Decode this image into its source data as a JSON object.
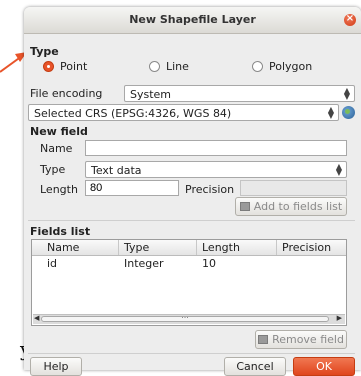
{
  "background_text": "y",
  "dialog": {
    "title": "New Shapefile Layer",
    "close_icon": "close-icon",
    "accent_color": "#e8542a"
  },
  "type": {
    "label": "Type",
    "options": [
      {
        "label": "Point",
        "checked": true
      },
      {
        "label": "Line",
        "checked": false
      },
      {
        "label": "Polygon",
        "checked": false
      }
    ]
  },
  "file_encoding": {
    "label": "File encoding",
    "value": "System"
  },
  "crs": {
    "value": "Selected CRS (EPSG:4326, WGS 84)",
    "icon": "globe-icon"
  },
  "new_field": {
    "label": "New field",
    "name_label": "Name",
    "name_value": "",
    "type_label": "Type",
    "type_value": "Text data",
    "length_label": "Length",
    "length_value": "80",
    "precision_label": "Precision",
    "precision_value": "",
    "add_button": "Add to fields list"
  },
  "fields_list": {
    "label": "Fields list",
    "columns": [
      "Name",
      "Type",
      "Length",
      "Precision"
    ],
    "rows": [
      {
        "name": "id",
        "type": "Integer",
        "length": "10",
        "precision": ""
      }
    ],
    "scrollbar_center": "...",
    "remove_button": "Remove field"
  },
  "buttons": {
    "help": "Help",
    "cancel": "Cancel",
    "ok": "OK"
  }
}
